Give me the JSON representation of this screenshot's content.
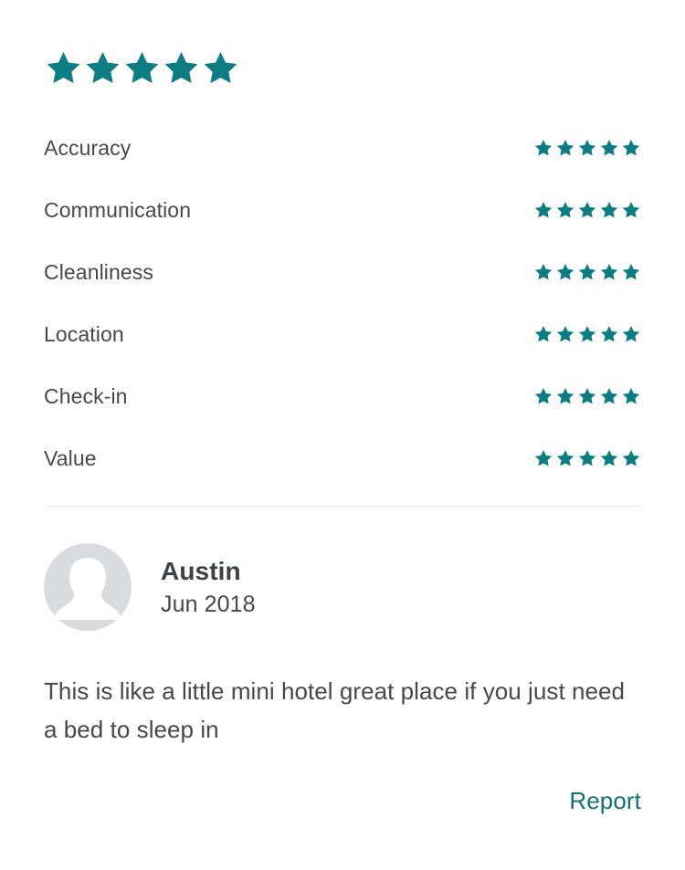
{
  "colors": {
    "star": "#0d7d84",
    "link": "#0f7276",
    "text": "#484848",
    "name": "#3c4144",
    "divider": "#ebebeb",
    "avatar_bg": "#d8dce0",
    "background": "#ffffff"
  },
  "overall_rating": {
    "icon": "star-icon",
    "value": 5,
    "max": 5
  },
  "categories": [
    {
      "label": "Accuracy",
      "rating": 5,
      "max": 5
    },
    {
      "label": "Communication",
      "rating": 5,
      "max": 5
    },
    {
      "label": "Cleanliness",
      "rating": 5,
      "max": 5
    },
    {
      "label": "Location",
      "rating": 5,
      "max": 5
    },
    {
      "label": "Check-in",
      "rating": 5,
      "max": 5
    },
    {
      "label": "Value",
      "rating": 5,
      "max": 5
    }
  ],
  "reviewer": {
    "name": "Austin",
    "date": "Jun 2018",
    "avatar_icon": "user-silhouette-icon"
  },
  "review": {
    "text": "This is like a little mini hotel great place if you just need a bed to sleep in"
  },
  "actions": {
    "report_label": "Report"
  }
}
